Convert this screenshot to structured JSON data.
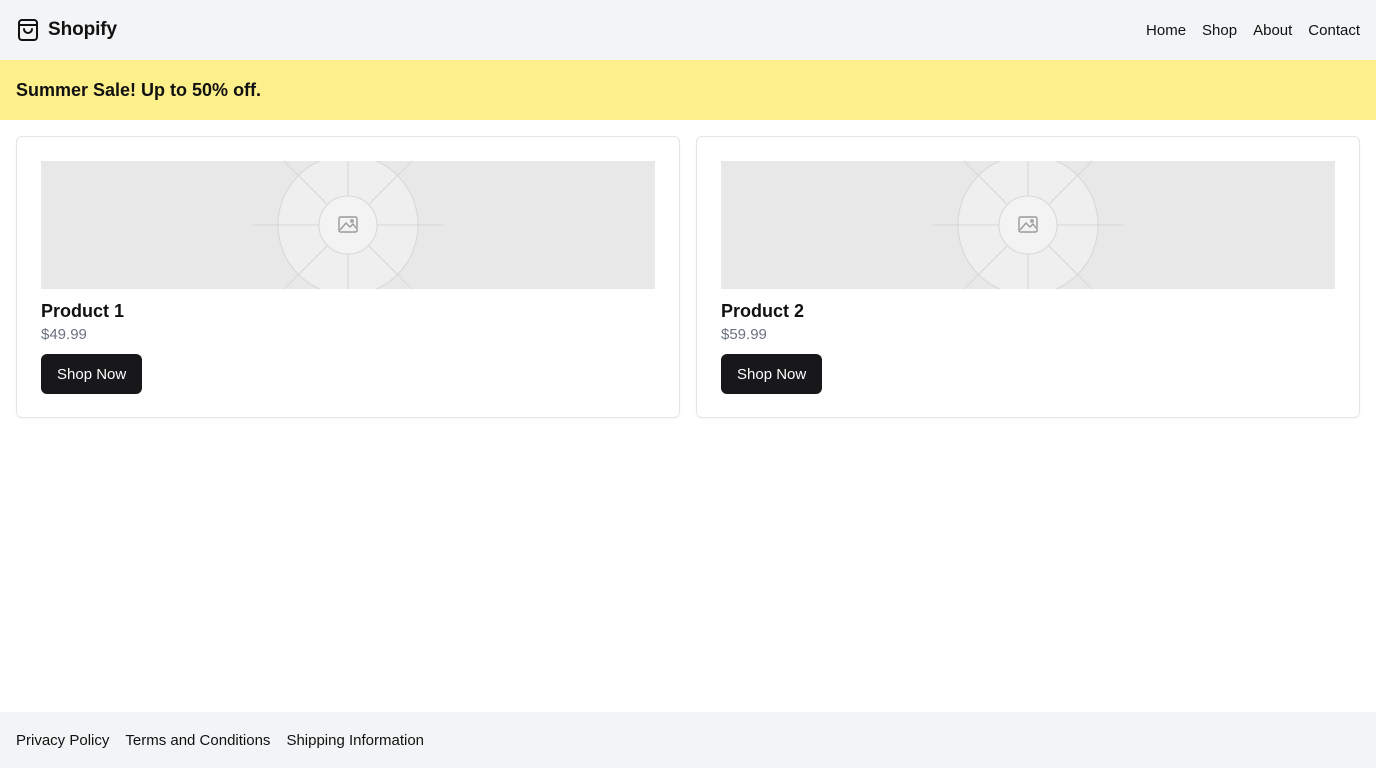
{
  "header": {
    "brand_icon": "shopping-bag-icon",
    "brand_name": "Shopify",
    "nav": [
      {
        "label": "Home"
      },
      {
        "label": "Shop"
      },
      {
        "label": "About"
      },
      {
        "label": "Contact"
      }
    ]
  },
  "banner": {
    "text": "Summer Sale! Up to 50% off.",
    "background": "#fdf08b"
  },
  "products": [
    {
      "image_icon": "image-placeholder-icon",
      "title": "Product 1",
      "price": "$49.99",
      "button_label": "Shop Now"
    },
    {
      "image_icon": "image-placeholder-icon",
      "title": "Product 2",
      "price": "$59.99",
      "button_label": "Shop Now"
    }
  ],
  "footer": {
    "links": [
      {
        "label": "Privacy Policy"
      },
      {
        "label": "Terms and Conditions"
      },
      {
        "label": "Shipping Information"
      }
    ]
  },
  "colors": {
    "header_bg": "#f2f4f6",
    "button_bg": "#18181b",
    "price_text": "#6b7280"
  }
}
